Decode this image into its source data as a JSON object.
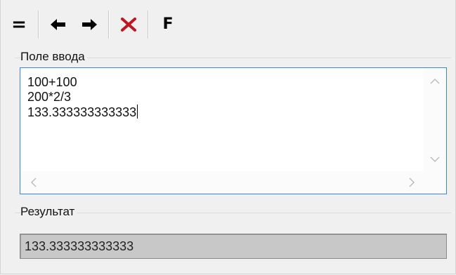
{
  "toolbar": {
    "equals_label": "=",
    "back_label": "⬅",
    "forward_label": "➡",
    "clear_label": "✕",
    "f_label": "F"
  },
  "input_group": {
    "label": "Поле ввода",
    "lines": [
      "100+100",
      "200*2/3",
      "133.333333333333"
    ]
  },
  "result_group": {
    "label": "Результат",
    "value": "133.333333333333"
  },
  "colors": {
    "accent_border": "#3c86d4",
    "clear_icon": "#c0161f"
  }
}
